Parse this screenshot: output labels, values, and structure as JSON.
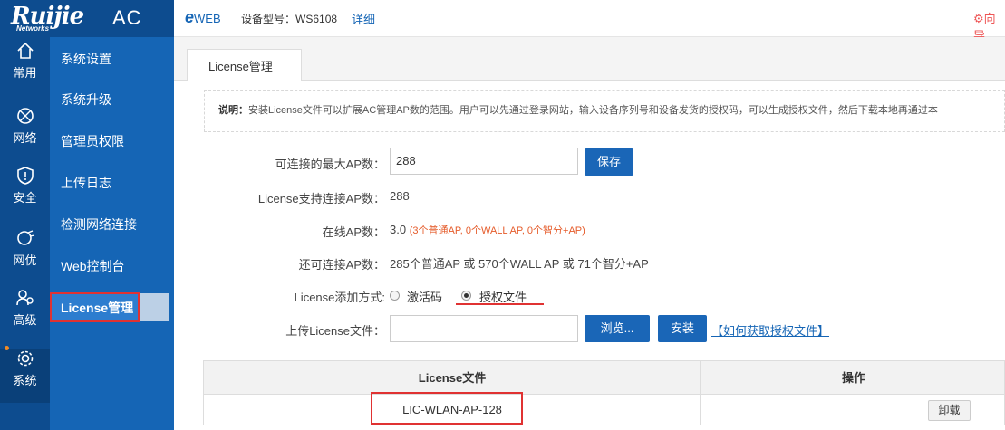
{
  "brand": {
    "logo": "Ruijie",
    "logo_sub": "Networks",
    "product": "AC"
  },
  "topbar": {
    "eweb": "WEB",
    "device_type_label": "设备型号：",
    "device_type_value": "WS6108",
    "detail_link": "详细",
    "guide": "向导"
  },
  "rail": [
    {
      "label": "常用",
      "icon": "home-icon"
    },
    {
      "label": "网络",
      "icon": "network-icon"
    },
    {
      "label": "安全",
      "icon": "shield-icon"
    },
    {
      "label": "网优",
      "icon": "optimize-icon"
    },
    {
      "label": "高级",
      "icon": "users-icon"
    },
    {
      "label": "系统",
      "icon": "gear-icon"
    }
  ],
  "submenu": [
    {
      "label": "系统设置"
    },
    {
      "label": "系统升级"
    },
    {
      "label": "管理员权限"
    },
    {
      "label": "上传日志"
    },
    {
      "label": "检测网络连接"
    },
    {
      "label": "Web控制台"
    },
    {
      "label": "License管理"
    }
  ],
  "tab": {
    "label": "License管理"
  },
  "notice": {
    "prefix": "说明：",
    "text": "安装License文件可以扩展AC管理AP数的范围。用户可以先通过登录网站，输入设备序列号和设备发货的授权码，可以生成授权文件，然后下载本地再通过本"
  },
  "form": {
    "max_ap_label": "可连接的最大AP数：",
    "max_ap_value": "288",
    "save_button": "保存",
    "license_ap_label": "License支持连接AP数：",
    "license_ap_value": "288",
    "online_ap_label": "在线AP数：",
    "online_ap_value": "3.0",
    "online_ap_detail": "(3个普通AP, 0个WALL AP, 0个智分+AP)",
    "remaining_label": "还可连接AP数：",
    "remaining_value": "285个普通AP 或 570个WALL AP 或 71个智分+AP",
    "add_method_label": "License添加方式:",
    "method_code": "激活码",
    "method_file": "授权文件",
    "upload_label": "上传License文件：",
    "upload_value": "",
    "browse_button": "浏览...",
    "install_button": "安装",
    "howto_link": "【如何获取授权文件】"
  },
  "table": {
    "headers": [
      "License文件",
      "操作"
    ],
    "rows": [
      {
        "file": "LIC-WLAN-AP-128",
        "action": "卸载"
      }
    ]
  },
  "colors": {
    "rail": "#0d4c8f",
    "submenu": "#1565b5",
    "primary_button": "#1a66b7",
    "highlight": "#e03232"
  }
}
